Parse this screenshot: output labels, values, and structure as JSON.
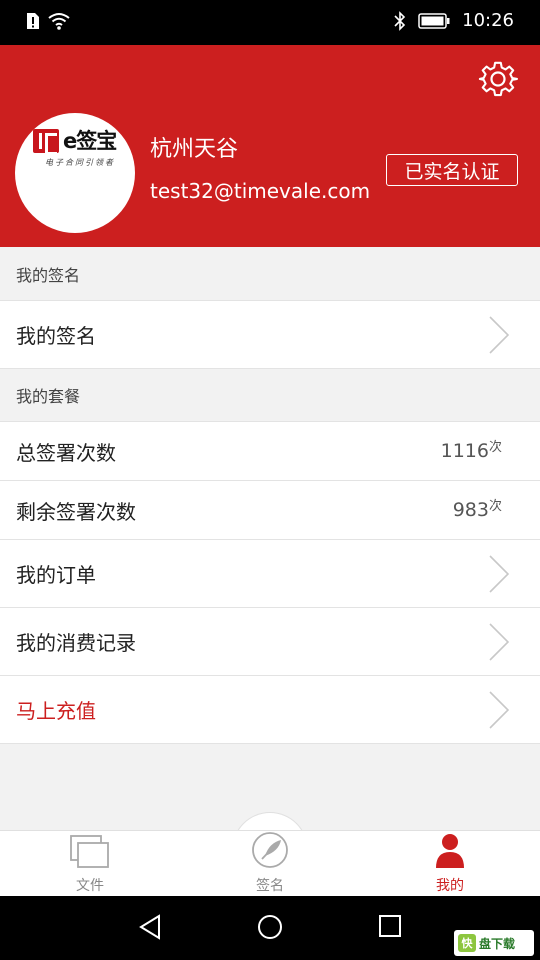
{
  "status_bar": {
    "time": "10:26",
    "icons": [
      "alert-sim-icon",
      "wifi-icon",
      "bluetooth-icon",
      "battery-icon"
    ]
  },
  "header": {
    "logo_text": "e签宝",
    "logo_subtitle": "电子合同引领者",
    "user_name": "杭州天谷",
    "email": "test32@timevale.com",
    "verify_badge": "已实名认证",
    "bg_color": "#cc1f1f"
  },
  "sections": {
    "signature_header": "我的签名",
    "signature_row": "我的签名",
    "package_header": "我的套餐",
    "total_sign_label": "总签署次数",
    "total_sign_value": "1116",
    "total_sign_unit": "次",
    "remaining_sign_label": "剩余签署次数",
    "remaining_sign_value": "983",
    "remaining_sign_unit": "次",
    "orders_label": "我的订单",
    "consumption_label": "我的消费记录",
    "recharge_label": "马上充值"
  },
  "tabbar": {
    "files_label": "文件",
    "sign_label": "签名",
    "mine_label": "我的",
    "active_color": "#cc1f1f"
  },
  "nav_bar": {
    "icons": [
      "back-icon",
      "home-icon",
      "recents-icon"
    ]
  },
  "watermark": {
    "icon_text": "快",
    "text": "盘下载"
  }
}
